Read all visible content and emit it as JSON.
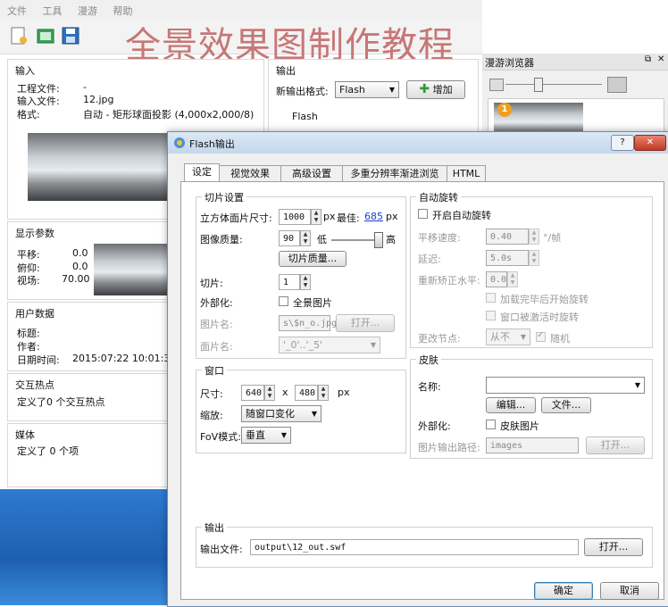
{
  "watermark": "全景效果图制作教程",
  "menu": [
    "文件",
    "工具",
    "漫游",
    "帮助"
  ],
  "input_panel": {
    "title": "输入",
    "rows": [
      {
        "label": "工程文件:",
        "value": "-"
      },
      {
        "label": "输入文件:",
        "value": "12.jpg"
      },
      {
        "label": "格式:",
        "value": "自动 - 矩形球面投影 (4,000x2,000/8)"
      }
    ]
  },
  "display_panel": {
    "title": "显示参数",
    "rows": [
      {
        "label": "平移:",
        "value": "0.0"
      },
      {
        "label": "俯仰:",
        "value": "0.0"
      },
      {
        "label": "视场:",
        "value": "70.00"
      }
    ]
  },
  "user_panel": {
    "title": "用户数据",
    "rows": [
      {
        "label": "标题:",
        "value": ""
      },
      {
        "label": "作者:",
        "value": ""
      },
      {
        "label": "日期时间:",
        "value": "2015:07:22 10:01:31"
      }
    ]
  },
  "hotspot_panel": {
    "title": "交互热点",
    "text": "定义了0 个交互热点"
  },
  "media_panel": {
    "title": "媒体",
    "text": "定义了 0 个项"
  },
  "output_panel": {
    "title": "输出",
    "format_label": "新输出格式:",
    "format_value": "Flash",
    "add_label": "增加",
    "sub_title": "Flash"
  },
  "browser": {
    "title": "漫游浏览器",
    "badge": "1"
  },
  "dialog": {
    "title": "Flash输出",
    "tabs": [
      "设定",
      "视觉效果",
      "高级设置",
      "多重分辨率渐进浏览",
      "HTML"
    ],
    "tile": {
      "title": "切片设置",
      "face_size_label": "立方体面片尺寸:",
      "face_size_value": "1000",
      "unit_px": "px",
      "best_label": "最佳:",
      "best_value": "685",
      "best_unit": "px",
      "quality_label": "图像质量:",
      "quality_value": "90",
      "quality_low": "低",
      "quality_high": "高",
      "quality_slider": 0.92,
      "tile_quality_btn": "切片质量...",
      "tiles_label": "切片:",
      "tiles_value": "1",
      "external_label": "外部化:",
      "external_check_label": "全景图片",
      "imgname_label": "图片名:",
      "imgname_value": "s\\$n_o.jpg",
      "open_btn": "打开...",
      "facename_label": "面片名:",
      "facename_value": "'_0'..'_5'"
    },
    "autorotate": {
      "title": "自动旋转",
      "enable_label": "开启自动旋转",
      "speed_label": "平移速度:",
      "speed_value": "0.40",
      "speed_unit": "°/帧",
      "delay_label": "延迟:",
      "delay_value": "5.0s",
      "recenter_label": "重新矫正水平:",
      "recenter_value": "0.0",
      "start_after_load": "加载完毕后开始旋转",
      "start_on_activate": "窗口被激活时旋转",
      "change_node_label": "更改节点:",
      "change_node_value": "从不",
      "random_label": "随机"
    },
    "window": {
      "title": "窗口",
      "size_label": "尺寸:",
      "width": "640",
      "x": "x",
      "height": "480",
      "unit": "px",
      "scale_label": "缩放:",
      "scale_value": "随窗口变化",
      "fov_label": "FoV模式:",
      "fov_value": "垂直"
    },
    "skin": {
      "title": "皮肤",
      "name_label": "名称:",
      "name_value": "",
      "edit_btn": "编辑...",
      "file_btn": "文件...",
      "external_label": "外部化:",
      "external_check_label": "皮肤图片",
      "outpath_label": "图片输出路径:",
      "outpath_value": "images",
      "open_btn": "打开..."
    },
    "output": {
      "title": "输出",
      "file_label": "输出文件:",
      "file_value": "output\\12_out.swf",
      "open_btn": "打开..."
    },
    "ok": "确定",
    "cancel": "取消",
    "help": "?"
  }
}
